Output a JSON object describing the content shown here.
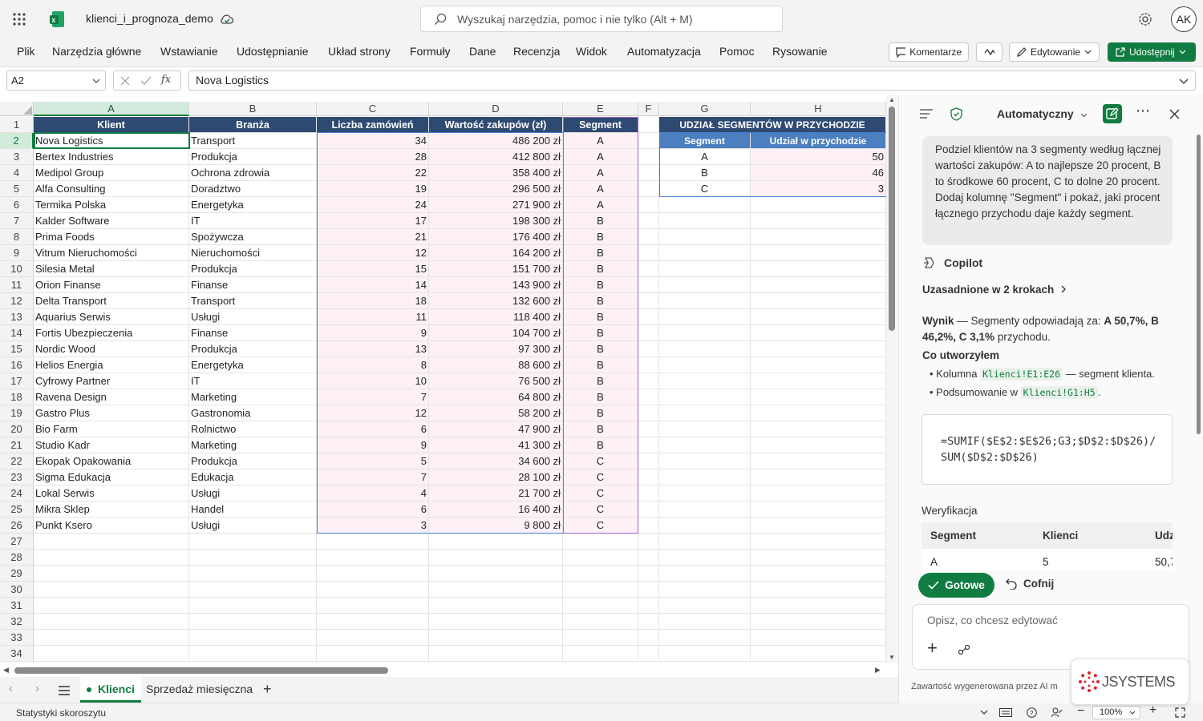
{
  "titlebar": {
    "file_name": "klienci_i_prognoza_demo",
    "search_placeholder": "Wyszukaj narzędzia, pomoc i nie tylko (Alt + M)",
    "avatar": "AK"
  },
  "ribbon": {
    "menu": [
      "Plik",
      "Narzędzia główne",
      "Wstawianie",
      "Udostępnianie",
      "Układ strony",
      "Formuły",
      "Dane",
      "Recenzja",
      "Widok",
      "Automatyzacja",
      "Pomoc",
      "Rysowanie"
    ],
    "comments": "Komentarze",
    "editing": "Edytowanie",
    "share": "Udostępnij"
  },
  "formula_bar": {
    "name_box": "A2",
    "fx": "fx",
    "value": "Nova Logistics"
  },
  "columns": [
    "A",
    "B",
    "C",
    "D",
    "E",
    "F",
    "G",
    "H"
  ],
  "headers": {
    "klient": "Klient",
    "branza": "Branża",
    "zamowienia": "Liczba zamówień",
    "wartosc": "Wartość zakupów (zł)",
    "segment": "Segment"
  },
  "rows": [
    [
      "Nova Logistics",
      "Transport",
      "34",
      "486 200 zł",
      "A"
    ],
    [
      "Bertex Industries",
      "Produkcja",
      "28",
      "412 800 zł",
      "A"
    ],
    [
      "Medipol Group",
      "Ochrona zdrowia",
      "22",
      "358 400 zł",
      "A"
    ],
    [
      "Alfa Consulting",
      "Doradztwo",
      "19",
      "296 500 zł",
      "A"
    ],
    [
      "Termika Polska",
      "Energetyka",
      "24",
      "271 900 zł",
      "A"
    ],
    [
      "Kalder Software",
      "IT",
      "17",
      "198 300 zł",
      "B"
    ],
    [
      "Prima Foods",
      "Spożywcza",
      "21",
      "176 400 zł",
      "B"
    ],
    [
      "Vitrum Nieruchomości",
      "Nieruchomości",
      "12",
      "164 200 zł",
      "B"
    ],
    [
      "Silesia Metal",
      "Produkcja",
      "15",
      "151 700 zł",
      "B"
    ],
    [
      "Orion Finanse",
      "Finanse",
      "14",
      "143 900 zł",
      "B"
    ],
    [
      "Delta Transport",
      "Transport",
      "18",
      "132 600 zł",
      "B"
    ],
    [
      "Aquarius Serwis",
      "Usługi",
      "11",
      "118 400 zł",
      "B"
    ],
    [
      "Fortis Ubezpieczenia",
      "Finanse",
      "9",
      "104 700 zł",
      "B"
    ],
    [
      "Nordic Wood",
      "Produkcja",
      "13",
      "97 300 zł",
      "B"
    ],
    [
      "Helios Energia",
      "Energetyka",
      "8",
      "88 600 zł",
      "B"
    ],
    [
      "Cyfrowy Partner",
      "IT",
      "10",
      "76 500 zł",
      "B"
    ],
    [
      "Ravena Design",
      "Marketing",
      "7",
      "64 800 zł",
      "B"
    ],
    [
      "Gastro Plus",
      "Gastronomia",
      "12",
      "58 200 zł",
      "B"
    ],
    [
      "Bio Farm",
      "Rolnictwo",
      "6",
      "47 900 zł",
      "B"
    ],
    [
      "Studio Kadr",
      "Marketing",
      "9",
      "41 300 zł",
      "B"
    ],
    [
      "Ekopak Opakowania",
      "Produkcja",
      "5",
      "34 600 zł",
      "C"
    ],
    [
      "Sigma Edukacja",
      "Edukacja",
      "7",
      "28 100 zł",
      "C"
    ],
    [
      "Lokal Serwis",
      "Usługi",
      "4",
      "21 700 zł",
      "C"
    ],
    [
      "Mikra Sklep",
      "Handel",
      "6",
      "16 400 zł",
      "C"
    ],
    [
      "Punkt Ksero",
      "Usługi",
      "3",
      "9 800 zł",
      "C"
    ]
  ],
  "summary": {
    "title": "UDZIAŁ SEGMENTÓW W PRZYCHODZIE",
    "h_segment": "Segment",
    "h_share": "Udział w przychodzie",
    "rows": [
      [
        "A",
        "50"
      ],
      [
        "B",
        "46"
      ],
      [
        "C",
        "3"
      ]
    ]
  },
  "row_numbers": [
    "1",
    "2",
    "3",
    "4",
    "5",
    "6",
    "7",
    "8",
    "9",
    "10",
    "11",
    "12",
    "13",
    "14",
    "15",
    "16",
    "17",
    "18",
    "19",
    "20",
    "21",
    "22",
    "23",
    "24",
    "25",
    "26",
    "27",
    "28",
    "29",
    "30",
    "31",
    "32",
    "33",
    "34"
  ],
  "sheets": {
    "active": "Klienci",
    "other": "Sprzedaż miesięczna"
  },
  "status": {
    "left": "Statystyki skoroszytu",
    "zoom": "100%"
  },
  "copilot": {
    "mode": "Automatyczny",
    "user_message": "Podziel klientów na 3 segmenty według łącznej wartości zakupów: A to najlepsze 20 procent, B to środkowe 60 procent, C to dolne 20 procent. Dodaj kolumnę \"Segment\" i pokaż, jaki procent łącznego przychodu daje każdy segment.",
    "name": "Copilot",
    "steps": "Uzasadnione w 2 krokach",
    "result_label": "Wynik",
    "result_text": " — Segmenty odpowiadają za: ",
    "result_a": "A 50,7%, B 46,2%, C 3,1%",
    "result_tail": " przychodu.",
    "created": "Co utworzyłem",
    "b1_pre": "Kolumna ",
    "b1_code": "Klienci!E1:E26",
    "b1_post": " — segment klienta.",
    "b2_pre": "Podsumowanie w ",
    "b2_code": "Klienci!G1:H5",
    "b2_post": ".",
    "formula": "=SUMIF($E$2:$E$26;G3;$D$2:$D$26)/SUM($D$2:$D$26)",
    "verify": "Weryfikacja",
    "v_h1": "Segment",
    "v_h2": "Klienci",
    "v_h3": "Udz",
    "v_r1": "A",
    "v_r2": "5",
    "v_r3": "50,7",
    "done": "Gotowe",
    "undo": "Cofnij",
    "input_placeholder": "Opisz, co chcesz edytować",
    "footer": "Zawartość wygenerowana przez AI m",
    "logo": "JSYSTEMS"
  }
}
